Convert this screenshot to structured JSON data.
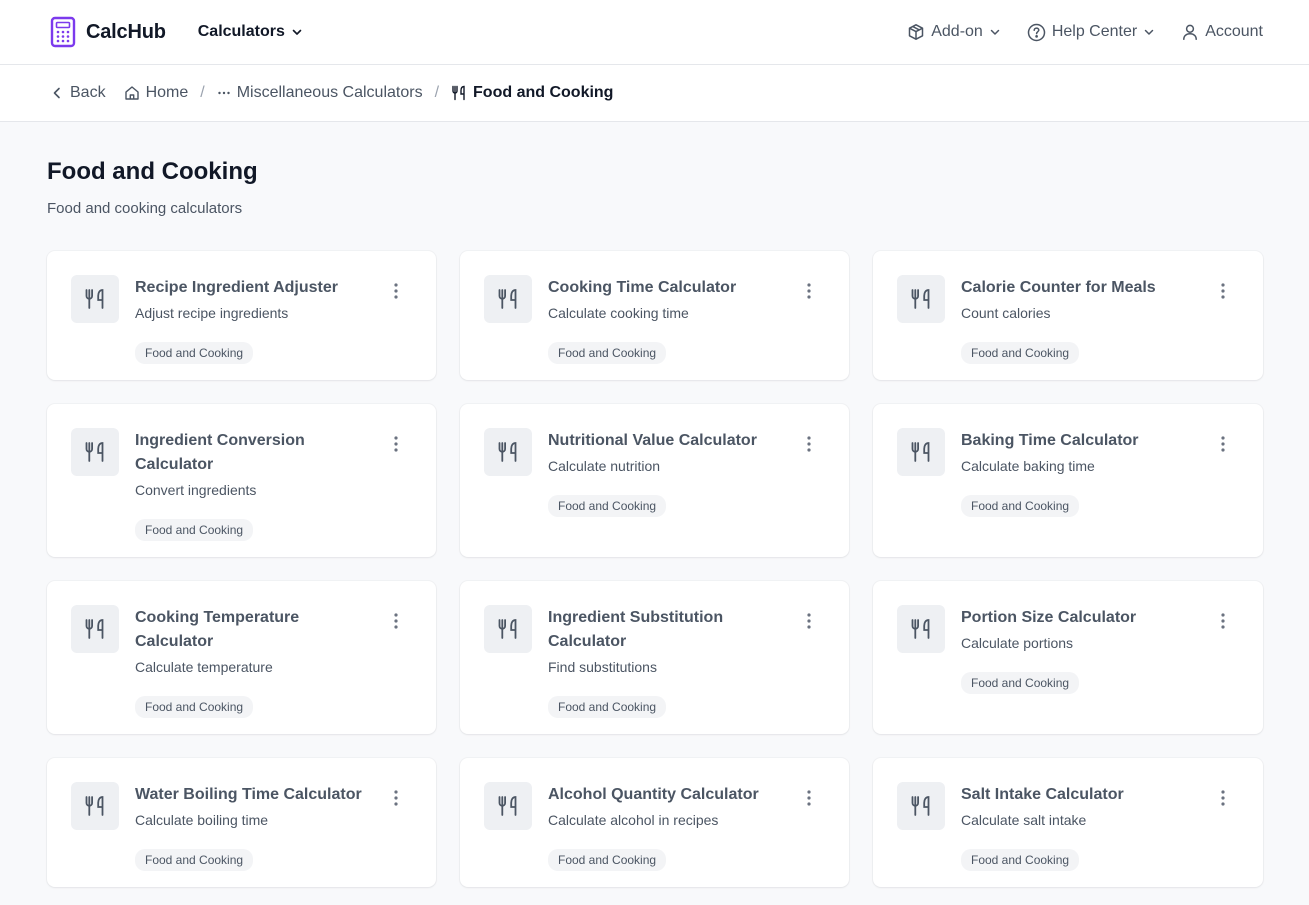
{
  "brand": {
    "name": "CalcHub",
    "accent": "#7c3aed"
  },
  "nav": {
    "calculators_label": "Calculators",
    "addon_label": "Add-on",
    "help_label": "Help Center",
    "account_label": "Account"
  },
  "breadcrumb": {
    "back_label": "Back",
    "home_label": "Home",
    "parent_label": "Miscellaneous Calculators",
    "current_label": "Food and Cooking"
  },
  "page": {
    "title": "Food and Cooking",
    "subtitle": "Food and cooking calculators"
  },
  "cards": [
    {
      "title": "Recipe Ingredient Adjuster",
      "desc": "Adjust recipe ingredients",
      "tag": "Food and Cooking",
      "icon": "utensils-icon"
    },
    {
      "title": "Cooking Time Calculator",
      "desc": "Calculate cooking time",
      "tag": "Food and Cooking",
      "icon": "utensils-icon"
    },
    {
      "title": "Calorie Counter for Meals",
      "desc": "Count calories",
      "tag": "Food and Cooking",
      "icon": "utensils-icon"
    },
    {
      "title": "Ingredient Conversion Calculator",
      "desc": "Convert ingredients",
      "tag": "Food and Cooking",
      "icon": "utensils-icon"
    },
    {
      "title": "Nutritional Value Calculator",
      "desc": "Calculate nutrition",
      "tag": "Food and Cooking",
      "icon": "utensils-icon"
    },
    {
      "title": "Baking Time Calculator",
      "desc": "Calculate baking time",
      "tag": "Food and Cooking",
      "icon": "utensils-icon"
    },
    {
      "title": "Cooking Temperature Calculator",
      "desc": "Calculate temperature",
      "tag": "Food and Cooking",
      "icon": "utensils-icon"
    },
    {
      "title": "Ingredient Substitution Calculator",
      "desc": "Find substitutions",
      "tag": "Food and Cooking",
      "icon": "utensils-icon"
    },
    {
      "title": "Portion Size Calculator",
      "desc": "Calculate portions",
      "tag": "Food and Cooking",
      "icon": "utensils-icon"
    },
    {
      "title": "Water Boiling Time Calculator",
      "desc": "Calculate boiling time",
      "tag": "Food and Cooking",
      "icon": "utensils-icon"
    },
    {
      "title": "Alcohol Quantity Calculator",
      "desc": "Calculate alcohol in recipes",
      "tag": "Food and Cooking",
      "icon": "utensils-icon"
    },
    {
      "title": "Salt Intake Calculator",
      "desc": "Calculate salt intake",
      "tag": "Food and Cooking",
      "icon": "utensils-icon"
    }
  ]
}
